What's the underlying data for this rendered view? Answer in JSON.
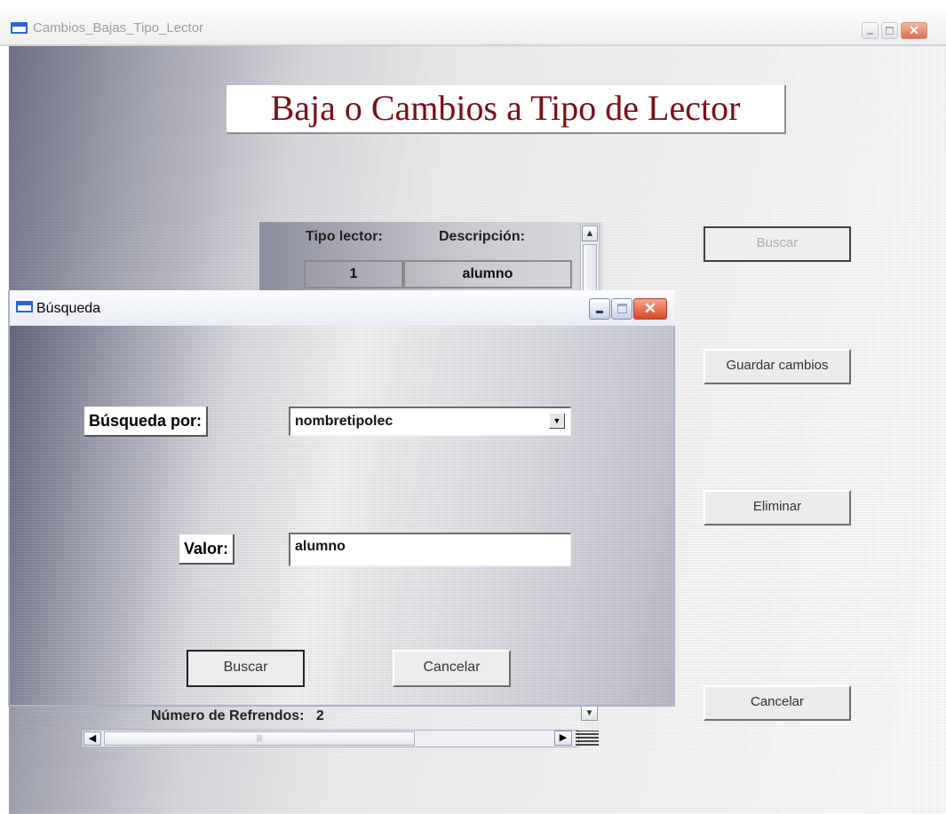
{
  "main_window": {
    "title": "Cambios_Bajas_Tipo_Lector",
    "heading": "Baja o Cambios a Tipo de Lector"
  },
  "grid": {
    "columns": [
      "Tipo lector:",
      "Descripción:"
    ],
    "rows": [
      {
        "tipo": "1",
        "descripcion": "alumno"
      }
    ],
    "footer_label": "Número de Refrendos:",
    "footer_value": "2"
  },
  "side_buttons": {
    "search": "Buscar",
    "save": "Guardar cambios",
    "delete": "Eliminar",
    "cancel": "Cancelar"
  },
  "dialog": {
    "title": "Búsqueda",
    "search_by_label": "Búsqueda por:",
    "search_by_value": "nombretipolec",
    "value_label": "Valor:",
    "value_input": "alumno",
    "search_button": "Buscar",
    "cancel_button": "Cancelar"
  },
  "colors": {
    "heading_text": "#7a0f16",
    "title_icon": "#2c64d8",
    "close_button": "#d8482a"
  },
  "icons": [
    "window-icon",
    "minimize-icon",
    "maximize-icon",
    "close-icon",
    "dropdown-arrow-icon",
    "scroll-up-icon",
    "scroll-down-icon",
    "scroll-left-icon",
    "scroll-right-icon"
  ]
}
